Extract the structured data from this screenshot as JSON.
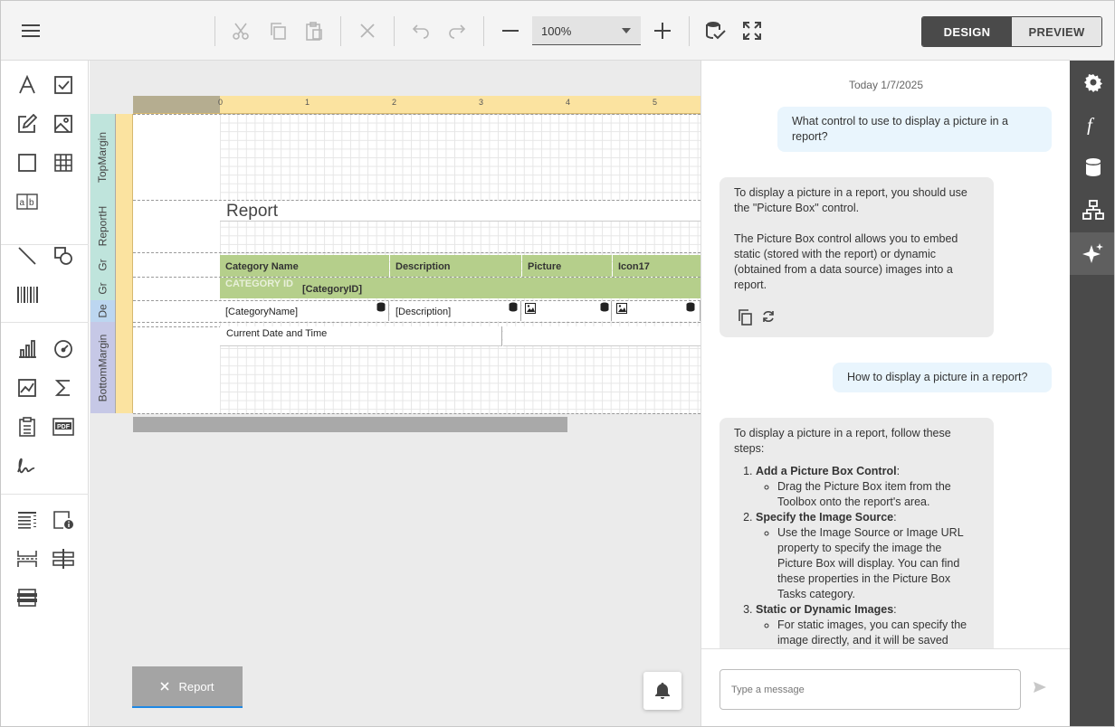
{
  "toolbar": {
    "menu_icon": "hamburger-icon",
    "zoom_value": "100%",
    "design_label": "DESIGN",
    "preview_label": "PREVIEW",
    "active_mode": "design"
  },
  "surface": {
    "ruler_marks": [
      "0",
      "1",
      "2",
      "3",
      "4",
      "5"
    ],
    "bands": [
      "TopMargin",
      "ReportH",
      "Gr",
      "Gr",
      "De",
      "BottomMargin"
    ],
    "report_title": "Report",
    "group_header": [
      "Category Name",
      "Description",
      "Picture",
      "Icon17"
    ],
    "group_row_label": "CATEGORY ID",
    "group_row_field": "[CategoryID]",
    "detail": [
      "[CategoryName]",
      "[Description]"
    ],
    "footer_text": "Current Date and Time"
  },
  "tabs": [
    {
      "label": "Report",
      "close_icon": "close-icon"
    }
  ],
  "chat": {
    "date": "Today 1/7/2025",
    "messages": [
      {
        "role": "user",
        "text": "What control to use to display a picture in a report?"
      },
      {
        "role": "assistant",
        "paragraphs": [
          "To display a picture in a report, you should use the \"Picture Box\" control.",
          "The Picture Box control allows you to embed static (stored with the report) or dynamic (obtained from a data source) images into a report."
        ]
      },
      {
        "role": "user",
        "text": "How to display a picture in a report?"
      },
      {
        "role": "assistant",
        "intro": "To display a picture in a report, follow these steps:",
        "steps": [
          {
            "title": "Add a Picture Box Control",
            "detail": "Drag the Picture Box item from the Toolbox onto the report's area."
          },
          {
            "title": "Specify the Image Source",
            "detail": "Use the Image Source or Image URL property to specify the image the Picture Box will display. You can find these properties in the Picture Box Tasks category."
          },
          {
            "title": "Static or Dynamic Images",
            "detail": "For static images, you can specify the image directly, and it will be saved"
          }
        ]
      }
    ],
    "input_placeholder": "Type a message"
  },
  "side_tabs": [
    "properties-gear-icon",
    "expressions-f-icon",
    "data-source-icon",
    "report-explorer-icon",
    "ai-assistant-sparkle-icon"
  ],
  "colors": {
    "accent": "#1e88e5",
    "dark": "#4a4a4a",
    "group_header": "#b5cf8b",
    "ruler": "#fbe3a0"
  }
}
